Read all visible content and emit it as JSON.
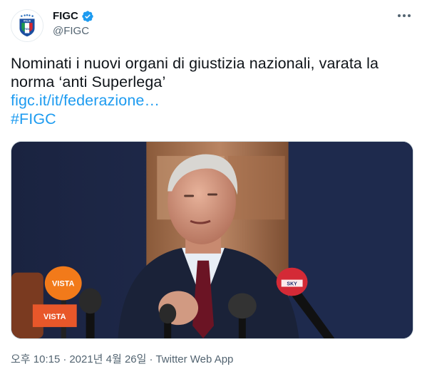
{
  "author": {
    "display_name": "FIGC",
    "handle": "@FIGC",
    "verified": true,
    "avatar_icon": "figc-crest-icon",
    "verified_icon": "verified-badge-icon"
  },
  "menu": {
    "icon": "more-options-icon"
  },
  "tweet": {
    "text_line_1": "Nominati i nuovi organi di giustizia nazionali, varata la",
    "text_line_2": "norma ‘anti Superlega’",
    "link_text": "figc.it/it/federazione…",
    "hashtag": "#FIGC"
  },
  "media": {
    "type": "photo",
    "mic_labels": [
      "VISTA",
      "VISTA",
      "SKY"
    ]
  },
  "meta": {
    "time": "오후 10:15",
    "date": "2021년 4월 26일",
    "separator": "·",
    "source": "Twitter Web App"
  },
  "colors": {
    "link": "#1d9bf0",
    "secondary_text": "#536471",
    "primary_text": "#0f1419",
    "verified": "#1d9bf0"
  }
}
